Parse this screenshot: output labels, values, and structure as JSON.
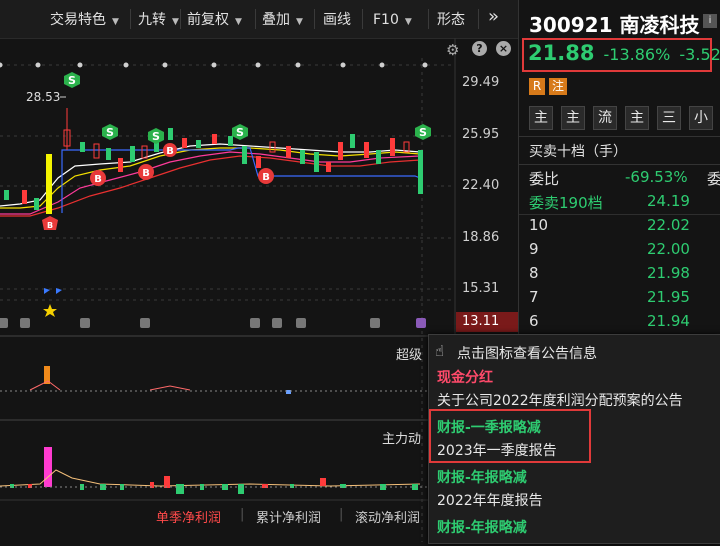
{
  "toolbar": {
    "items": [
      "交易特色",
      "九转",
      "前复权",
      "叠加",
      "画线",
      "F10",
      "形态"
    ],
    "more": "»"
  },
  "chart": {
    "price_labels": [
      "29.49",
      "25.95",
      "22.40",
      "18.86",
      "15.31",
      "13.11"
    ],
    "high_marker": "28.53",
    "indicator1_label": "超级",
    "indicator2_label": "主力动",
    "bottom_tabs": [
      "单季净利润",
      "累计净利润",
      "滚动净利润"
    ]
  },
  "stock": {
    "code": "300921",
    "name": "南凌科技",
    "price": "21.88",
    "change_pct": "-13.86%",
    "change": "-3.52",
    "badge_r": "R",
    "badge_note": "注"
  },
  "panel": {
    "buttons": [
      "主",
      "主",
      "流",
      "主",
      "三",
      "小"
    ],
    "order_book_title": "买卖十档（手）",
    "ratio_label": "委比",
    "ratio_value": "-69.53%",
    "ratio_extra": "委",
    "diff_label": "委卖190档",
    "diff_value": "24.19",
    "levels": [
      {
        "n": "10",
        "p": "22.02"
      },
      {
        "n": "9",
        "p": "22.00"
      },
      {
        "n": "8",
        "p": "21.98"
      },
      {
        "n": "7",
        "p": "21.95"
      },
      {
        "n": "6",
        "p": "21.94"
      }
    ]
  },
  "popup": {
    "hint": "点击图标查看公告信息",
    "sections": [
      {
        "title": "现金分红",
        "detail": "关于公司2022年度利润分配预案的公告"
      },
      {
        "title": "财报-一季报略减",
        "detail": "2023年一季度报告"
      },
      {
        "title": "财报-年报略减",
        "detail": "2022年年度报告"
      },
      {
        "title": "财报-年报略减",
        "detail": ""
      }
    ]
  },
  "colors": {
    "up": "#ff3b3b",
    "down": "#2ecc71",
    "accent": "#ff5d5d",
    "highlight_box": "#e03a3a"
  }
}
